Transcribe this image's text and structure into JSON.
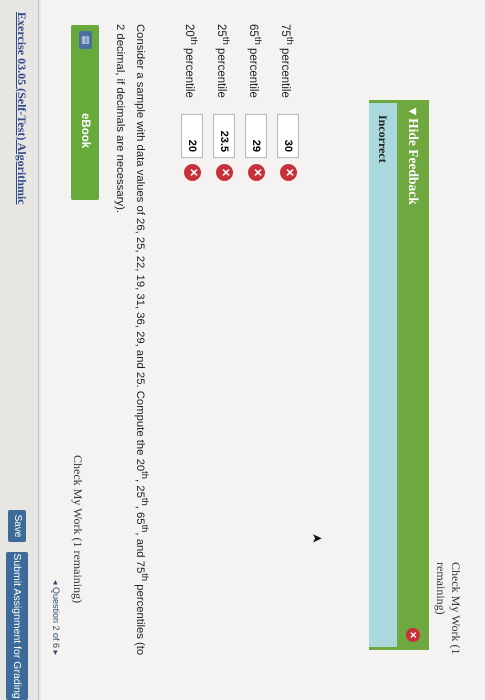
{
  "toolbar": {
    "save_label": "Save",
    "submit_label": "Submit Assignment for Grading"
  },
  "nav": {
    "question_indicator": "◂ Question 2 of 6 ▸"
  },
  "exercise": {
    "title": "Exercise 03.05 (Self-Test) Algorithmic"
  },
  "check_work": {
    "label": "Check My Work (1 remaining)"
  },
  "ebook": {
    "label": "eBook",
    "icon": "ebook-icon"
  },
  "question": {
    "text_before": "Consider a sample with data values of 26, 25, 22, 19, 31, 36, 29, and 25. Compute the 20",
    "sup1": "th",
    "sep1": ", 25",
    "sup2": "th",
    "sep2": ", 65",
    "sup3": "th",
    "sep3": ", and 75",
    "sup4": "th",
    "text_after": " percentiles (to 2 decimal, if decimals are necessary)."
  },
  "percentiles": [
    {
      "num": "20",
      "sup": "th",
      "suffix": " percentile",
      "value": "20",
      "status": "incorrect"
    },
    {
      "num": "25",
      "sup": "th",
      "suffix": " percentile",
      "value": "23.5",
      "status": "incorrect"
    },
    {
      "num": "65",
      "sup": "th",
      "suffix": " percentile",
      "value": "29",
      "status": "incorrect"
    },
    {
      "num": "75",
      "sup": "th",
      "suffix": " percentile",
      "value": "30",
      "status": "incorrect"
    }
  ],
  "feedback": {
    "toggle_label": "▾ Hide Feedback",
    "result": "Incorrect"
  },
  "colors": {
    "accent_blue": "#3c6b9a",
    "green": "#6ea83f",
    "error_red": "#c9313a",
    "feedback_blue": "#a9d8dd"
  }
}
